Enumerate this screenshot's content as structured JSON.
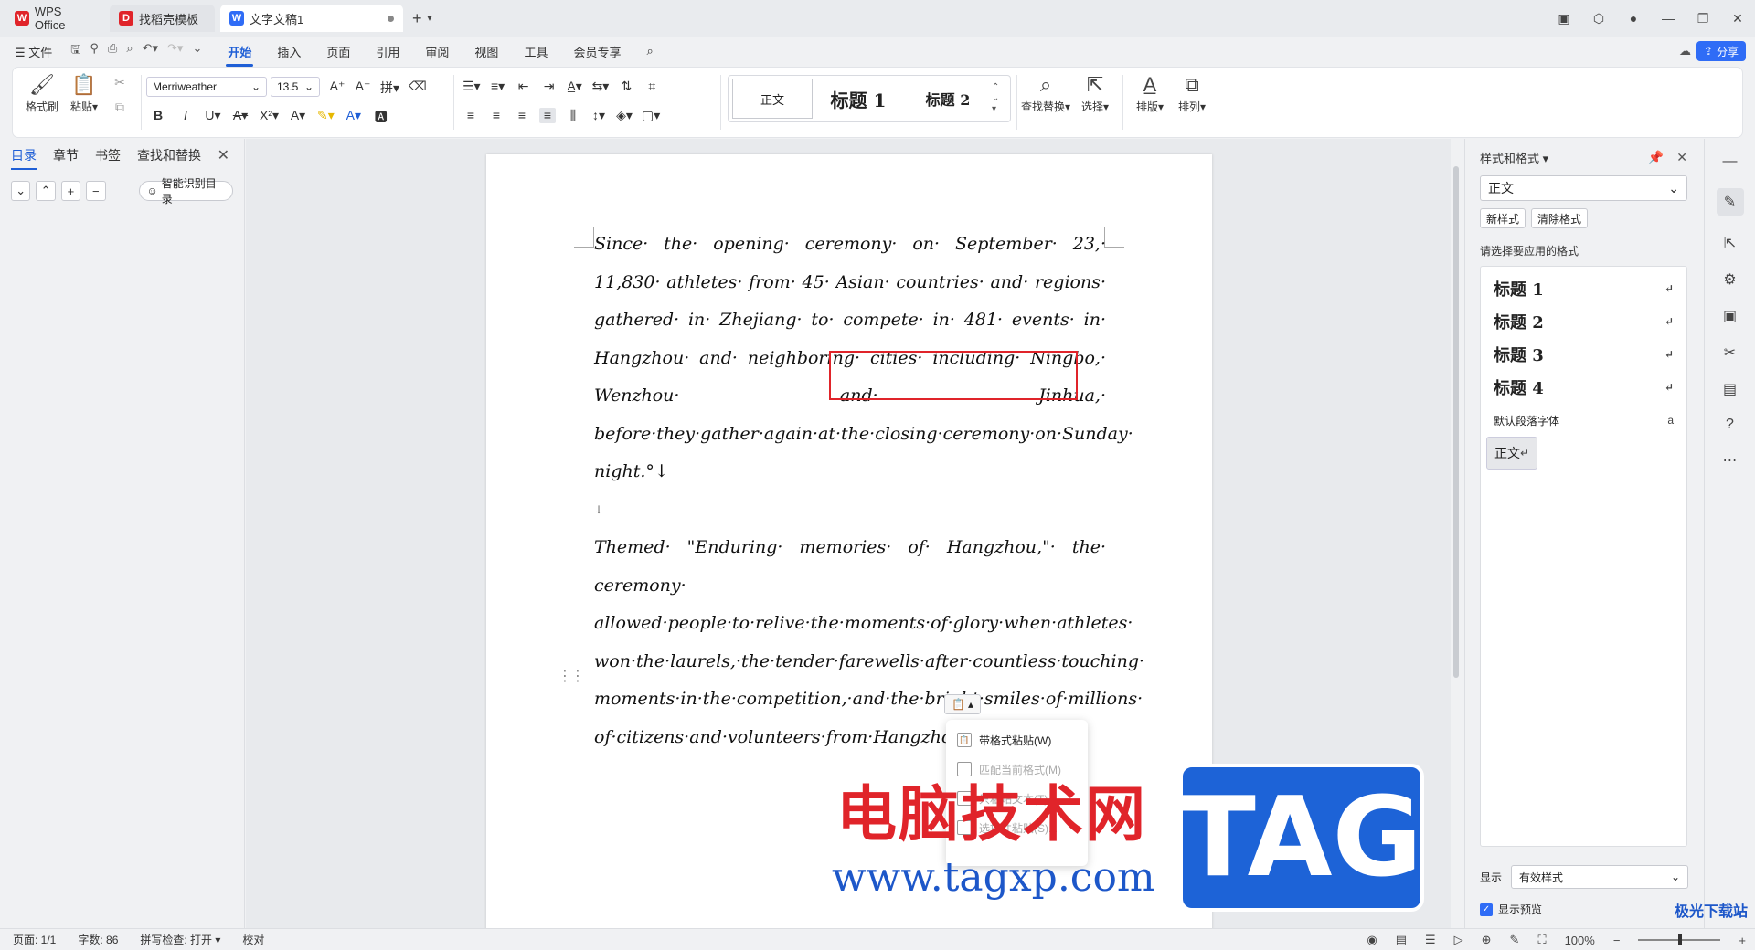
{
  "tabs": [
    {
      "label": "WPS Office",
      "icon": "wps-logo-icon"
    },
    {
      "label": "找稻壳模板",
      "icon": "daoke-logo-icon"
    },
    {
      "label": "文字文稿1",
      "icon": "writer-logo-icon"
    }
  ],
  "menu": {
    "file": "文件",
    "items": [
      "开始",
      "插入",
      "页面",
      "引用",
      "审阅",
      "视图",
      "工具",
      "会员专享"
    ],
    "active": "开始",
    "share": "分享"
  },
  "ribbon": {
    "format_painter": "格式刷",
    "paste": "粘贴",
    "font_name": "Merriweather",
    "font_size": "13.5",
    "styles": {
      "normal": "正文",
      "h1": "标题 1",
      "h2": "标题 2"
    },
    "find_replace": "查找替换",
    "select": "选择",
    "layout": "排版",
    "arrange": "排列"
  },
  "nav_pane": {
    "tabs": [
      "目录",
      "章节",
      "书签",
      "查找和替换"
    ],
    "active": "目录",
    "smart_toc": "智能识别目录"
  },
  "document": {
    "paragraph1": "Since· the· opening· ceremony· on· September· 23,· 11,830· athletes· from· 45· Asian· countries· and· regions· gathered· in· Zhejiang· to· compete· in· 481· events· in· Hangzhou· and· neighboring· cities· including· Ningbo,· Wenzhou· and· Jinhua,· before·they·gather·again·at·the·closing·ceremony·on·Sunday· night.°↓",
    "blank": "↓",
    "paragraph2": "Themed· \"Enduring· memories· of· Hangzhou,\"· the· ceremony· allowed·people·to·relive·the·moments·of·glory·when·athletes· won·the·laurels,·the·tender·farewells·after·countless·touching· moments·in·the·competition,·and·the·bright·smiles·of·millions· of·citizens·and·volunteers·from·Hangzhou.↓"
  },
  "paste_menu": {
    "items": [
      {
        "label": "带格式粘贴(W)",
        "enabled": true
      },
      {
        "label": "匹配当前格式(M)",
        "enabled": false
      },
      {
        "label": "只粘贴文本(T)",
        "enabled": false
      },
      {
        "label": "选择性粘贴(S)...",
        "enabled": false
      }
    ]
  },
  "watermark": {
    "cn": "电脑技术网",
    "url": "www.tagxp.com",
    "tag": "TAG",
    "small": "极光下载站"
  },
  "styles_panel": {
    "title": "样式和格式",
    "current": "正文",
    "new_style": "新样式",
    "clear_format": "清除格式",
    "apply_label": "请选择要应用的格式",
    "items": [
      {
        "label": "标题 1",
        "kind": "heading"
      },
      {
        "label": "标题 2",
        "kind": "heading"
      },
      {
        "label": "标题 3",
        "kind": "heading"
      },
      {
        "label": "标题 4",
        "kind": "heading"
      },
      {
        "label": "默认段落字体",
        "kind": "small"
      },
      {
        "label": "正文",
        "kind": "selected"
      }
    ],
    "show_label": "显示",
    "show_value": "有效样式",
    "preview_label": "显示预览"
  },
  "status": {
    "page": "页面: 1/1",
    "words": "字数: 86",
    "spell": "拼写检查: 打开",
    "proof": "校对",
    "zoom": "100%"
  },
  "colors": {
    "accent": "#1f5fd6",
    "share": "#2f6cf6",
    "highlight": "#e0242a"
  }
}
